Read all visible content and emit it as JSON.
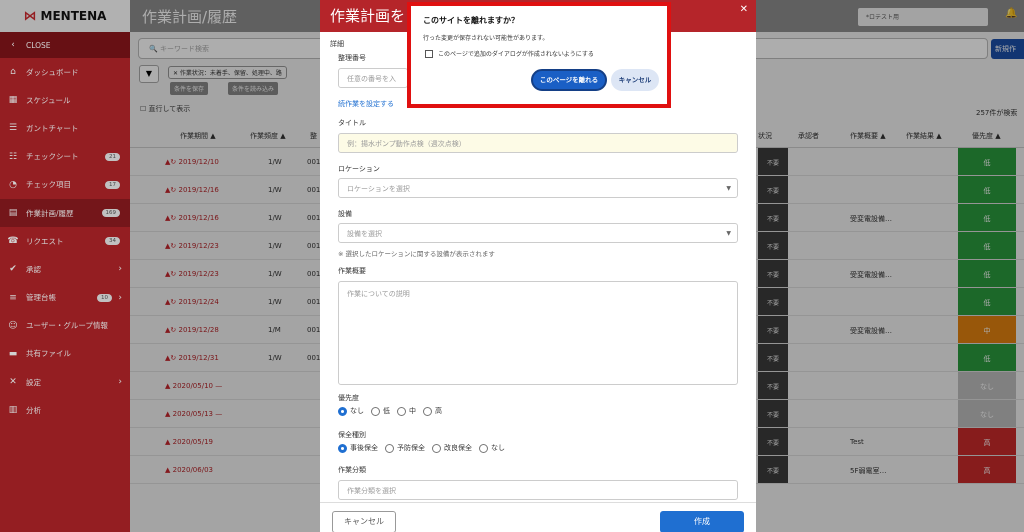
{
  "app": {
    "logo": "MENTENA",
    "page_title": "作業計画/履歴",
    "top_field": "*ロテスト用"
  },
  "sidebar": {
    "items": [
      {
        "label": "CLOSE",
        "icon": "chevron-left-icon",
        "glyph": "‹"
      },
      {
        "label": "ダッシュボード",
        "icon": "home-icon",
        "glyph": "⌂"
      },
      {
        "label": "スケジュール",
        "icon": "calendar-icon",
        "glyph": "▦"
      },
      {
        "label": "ガントチャート",
        "icon": "bars-icon",
        "glyph": "☰"
      },
      {
        "label": "チェックシート",
        "icon": "list-icon",
        "glyph": "☷",
        "badge": "21"
      },
      {
        "label": "チェック項目",
        "icon": "gauge-icon",
        "glyph": "◔",
        "badge": "17"
      },
      {
        "label": "作業計画/履歴",
        "icon": "document-icon",
        "glyph": "▤",
        "badge": "169"
      },
      {
        "label": "リクエスト",
        "icon": "phone-icon",
        "glyph": "☎",
        "badge": "34"
      },
      {
        "label": "承認",
        "icon": "thumbs-up-icon",
        "glyph": "✔",
        "arrow": "›"
      },
      {
        "label": "管理台帳",
        "icon": "database-icon",
        "glyph": "≡",
        "badge": "10",
        "arrow": "›"
      },
      {
        "label": "ユーザー・グループ情報",
        "icon": "users-icon",
        "glyph": "☺"
      },
      {
        "label": "共有ファイル",
        "icon": "folder-icon",
        "glyph": "▬"
      },
      {
        "label": "設定",
        "icon": "wrench-icon",
        "glyph": "✕",
        "arrow": "›"
      },
      {
        "label": "分析",
        "icon": "chart-icon",
        "glyph": "▥"
      }
    ]
  },
  "toolbar": {
    "search_placeholder": "キーワード検索",
    "new_button": "新規作",
    "filter_chip": "✕ 作業状況：未着手、保留、処理中、路",
    "save_filter": "条件を保存",
    "load_filter": "条件を読み込み",
    "show_past": "直行して表示",
    "count": "257件が検索"
  },
  "table": {
    "headers": [
      "作業期間 ▲",
      "作業頻度 ▲",
      "整",
      "状況",
      "承認者",
      "作業概要 ▲",
      "作業結果 ▲",
      "優先度 ▲"
    ],
    "rows": [
      {
        "date": "2019/12/10",
        "freq": "1/W",
        "num": "001",
        "status": "不要",
        "overview": "",
        "priority": "低",
        "pcolor": "#2a9a3d"
      },
      {
        "date": "2019/12/16",
        "freq": "1/W",
        "num": "001",
        "status": "不要",
        "overview": "",
        "priority": "低",
        "pcolor": "#2a9a3d"
      },
      {
        "date": "2019/12/16",
        "freq": "1/W",
        "num": "001",
        "status": "不要",
        "overview": "受変電設備…",
        "priority": "低",
        "pcolor": "#2a9a3d"
      },
      {
        "date": "2019/12/23",
        "freq": "1/W",
        "num": "001",
        "status": "不要",
        "overview": "",
        "priority": "低",
        "pcolor": "#2a9a3d"
      },
      {
        "date": "2019/12/23",
        "freq": "1/W",
        "num": "001",
        "status": "不要",
        "overview": "受変電設備…",
        "priority": "低",
        "pcolor": "#2a9a3d"
      },
      {
        "date": "2019/12/24",
        "freq": "1/W",
        "num": "001",
        "status": "不要",
        "overview": "",
        "priority": "低",
        "pcolor": "#2a9a3d"
      },
      {
        "date": "2019/12/28",
        "freq": "1/M",
        "num": "001",
        "status": "不要",
        "overview": "受変電設備…",
        "priority": "中",
        "pcolor": "#e08010"
      },
      {
        "date": "2019/12/31",
        "freq": "1/W",
        "num": "001",
        "status": "不要",
        "overview": "",
        "priority": "低",
        "pcolor": "#2a9a3d"
      },
      {
        "date": "2020/05/10 —",
        "freq": "",
        "num": "",
        "status": "不要",
        "overview": "",
        "priority": "なし",
        "pcolor": "#bdbdbd"
      },
      {
        "date": "2020/05/13 —",
        "freq": "",
        "num": "",
        "status": "不要",
        "overview": "",
        "priority": "なし",
        "pcolor": "#bdbdbd"
      },
      {
        "date": "2020/05/19",
        "freq": "",
        "num": "",
        "status": "不要",
        "overview": "Test",
        "priority": "高",
        "pcolor": "#c82a2a"
      },
      {
        "date": "2020/06/03",
        "freq": "",
        "num": "",
        "status": "不要",
        "overview": "5F弱電室…",
        "priority": "高",
        "pcolor": "#c82a2a"
      }
    ]
  },
  "modal": {
    "title": "作業計画を",
    "close": "✕",
    "section": "詳細",
    "mgmt_label": "整理番号",
    "mgmt_placeholder": "任意の番号を入",
    "continue_link": "続作業を設定する",
    "title_label": "タイトル",
    "title_placeholder": "例：揚水ポンプ動作点検（週次点検）",
    "location_label": "ロケーション",
    "location_placeholder": "ロケーションを選択",
    "equipment_label": "設備",
    "equipment_placeholder": "設備を選択",
    "equipment_help": "※ 選択したロケーションに関する設備が表示されます",
    "summary_label": "作業概要",
    "summary_placeholder": "作業についての説明",
    "priority_label": "優先度",
    "priority_options": [
      "なし",
      "低",
      "中",
      "高"
    ],
    "maint_label": "保全種別",
    "maint_options": [
      "事後保全",
      "予防保全",
      "改良保全",
      "なし"
    ],
    "category_label": "作業分類",
    "category_placeholder": "作業分類を選択",
    "cancel": "キャンセル",
    "create": "作成"
  },
  "dialog": {
    "title": "このサイトを離れますか？",
    "message": "行った変更が保存されない可能性があります。",
    "checkbox": "このページで追加のダイアログが作成されないようにする",
    "leave": "このページを離れる",
    "cancel": "キャンセル"
  }
}
